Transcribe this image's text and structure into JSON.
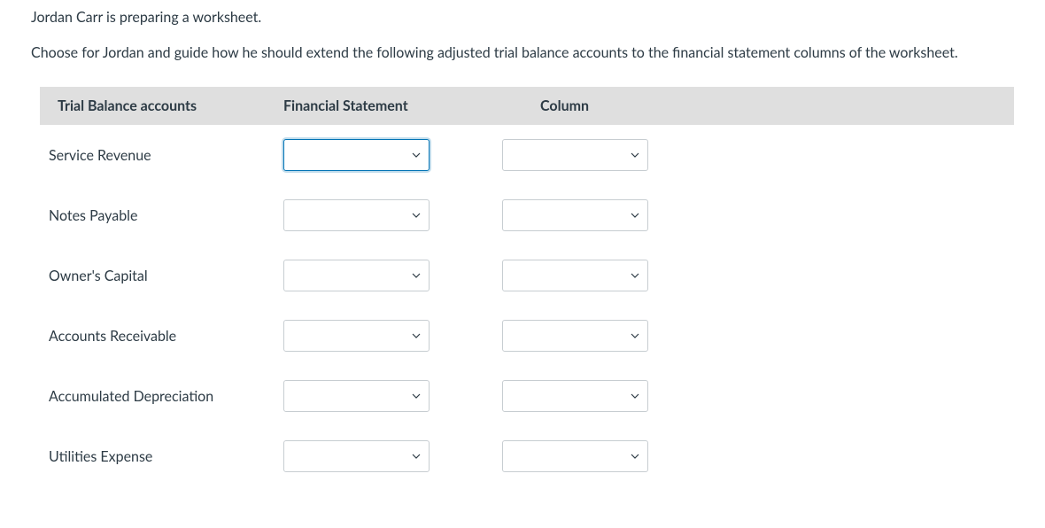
{
  "intro": {
    "p1": "Jordan Carr is preparing a worksheet.",
    "p2": "Choose for Jordan and guide how he should extend the following adjusted trial balance accounts to the financial statement columns of the worksheet."
  },
  "headers": {
    "col1": "Trial Balance accounts",
    "col2": "Financial Statement",
    "col3": "Column"
  },
  "rows": [
    {
      "label": "Service Revenue"
    },
    {
      "label": "Notes Payable"
    },
    {
      "label": "Owner's Capital"
    },
    {
      "label": "Accounts Receivable"
    },
    {
      "label": "Accumulated Depreciation"
    },
    {
      "label": "Utilities Expense"
    }
  ]
}
